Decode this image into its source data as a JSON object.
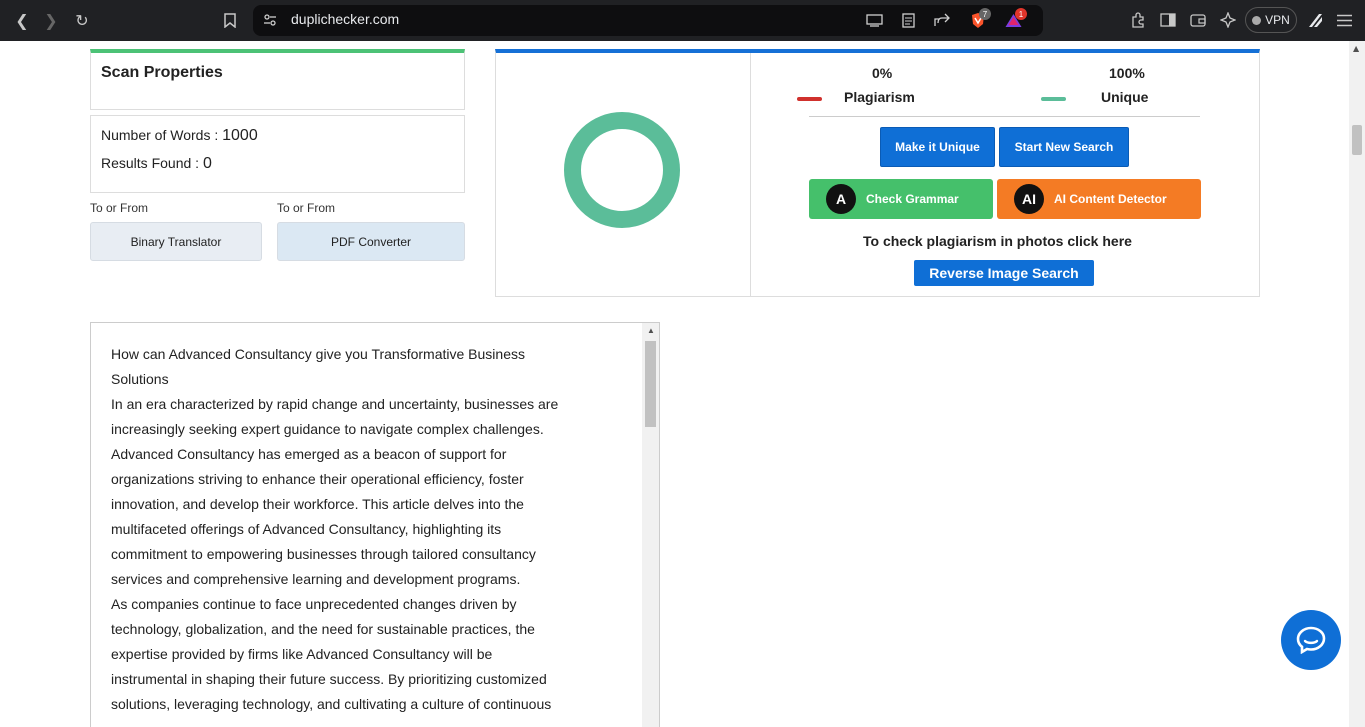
{
  "browser": {
    "url": "duplichecker.com",
    "vpn_label": "VPN",
    "brave_badge": "7",
    "alert_badge": "1"
  },
  "scan": {
    "title": "Scan Properties",
    "words_label": "Number of Words :",
    "words_value": "1000",
    "results_label": "Results Found :",
    "results_value": "0"
  },
  "tools": {
    "to_from_1": "To or From",
    "to_from_2": "To or From",
    "binary_label": "Binary Translator",
    "pdf_label": "PDF Converter"
  },
  "results": {
    "plagiarism_pct": "0%",
    "unique_pct": "100%",
    "plagiarism_label": "Plagiarism",
    "unique_label": "Unique",
    "plagiarism_fraction": 0,
    "unique_fraction": 1,
    "make_unique": "Make it Unique",
    "start_new": "Start New Search",
    "grammar": "Check Grammar",
    "ai_detector": "AI Content Detector",
    "photo_text": "To check plagiarism in photos click here",
    "reverse_image": "Reverse Image Search"
  },
  "colors": {
    "plagiarism": "#d0312d",
    "unique": "#5bbd99",
    "primary": "#0f6fd6",
    "grammar": "#45c06b",
    "ai": "#f47b24"
  },
  "article": {
    "lines": [
      "How can Advanced Consultancy give you Transformative Business",
      "Solutions",
      "In an era characterized by rapid change and uncertainty, businesses are",
      "increasingly seeking expert guidance to navigate complex challenges.",
      "Advanced Consultancy has emerged as a beacon of support for",
      "organizations striving to enhance their operational efficiency, foster",
      "innovation, and develop their workforce. This article delves into the",
      "multifaceted offerings of Advanced Consultancy, highlighting its",
      "commitment to empowering businesses through tailored consultancy",
      "services and comprehensive learning and development programs.",
      "As companies continue to face unprecedented changes driven by",
      "technology, globalization, and the need for sustainable practices, the",
      "expertise provided by firms like Advanced Consultancy will be",
      "instrumental in shaping their future success. By prioritizing customized",
      "solutions, leveraging technology, and cultivating a culture of continuous"
    ]
  }
}
